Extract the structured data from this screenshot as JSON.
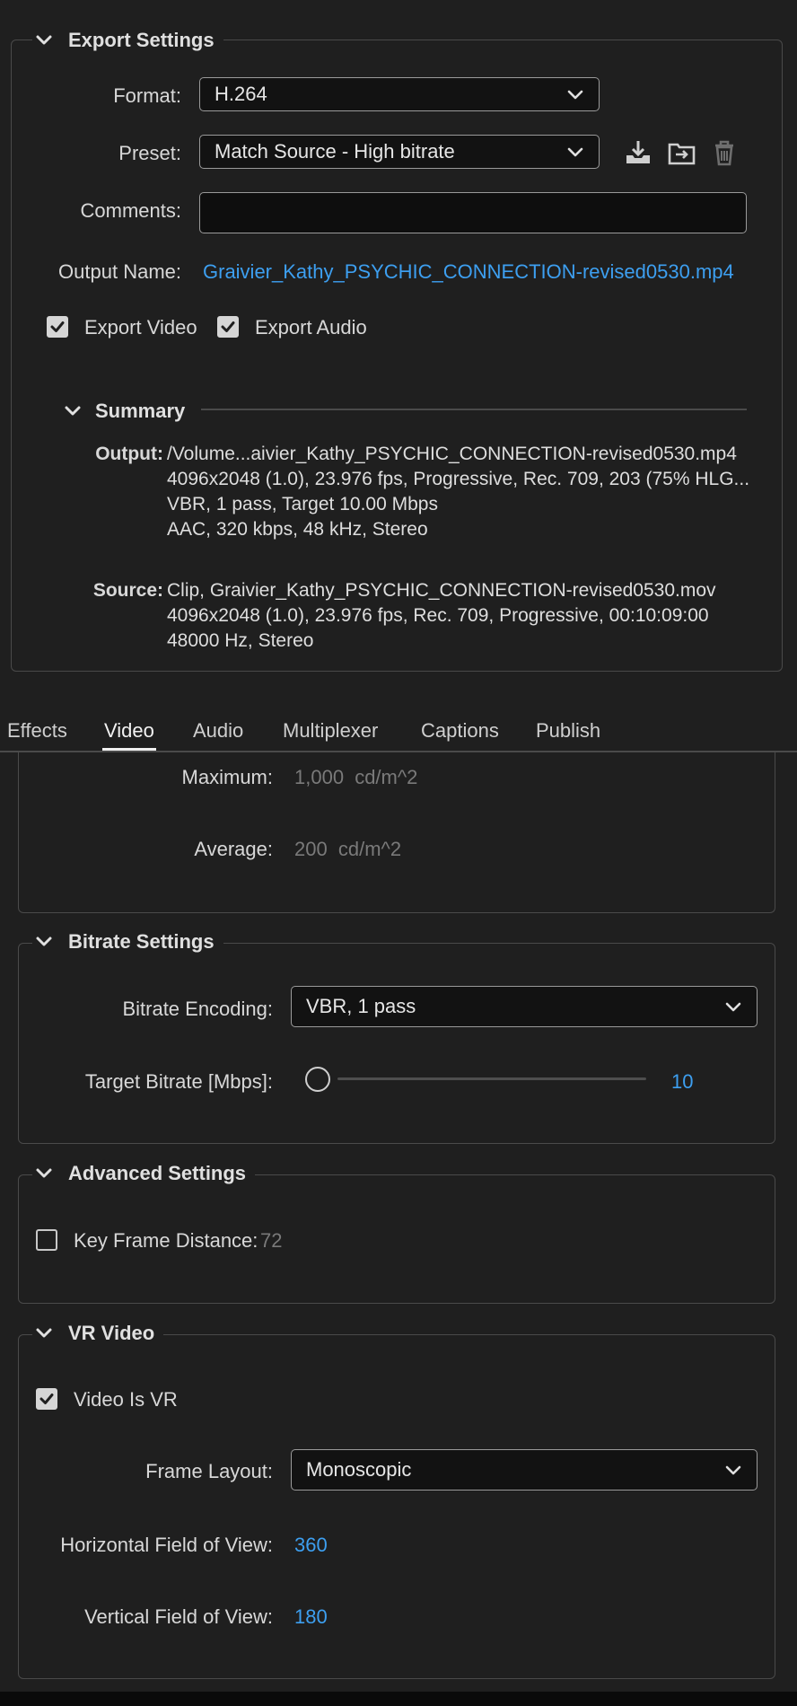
{
  "export_settings": {
    "title": "Export Settings",
    "format": {
      "label": "Format:",
      "value": "H.264"
    },
    "preset": {
      "label": "Preset:",
      "value": "Match Source - High bitrate"
    },
    "preset_icons": [
      "save-preset-icon",
      "import-preset-icon",
      "delete-preset-icon"
    ],
    "comments": {
      "label": "Comments:",
      "value": ""
    },
    "output_name": {
      "label": "Output Name:",
      "value": "Graivier_Kathy_PSYCHIC_CONNECTION-revised0530.mp4"
    },
    "export_video": {
      "label": "Export Video",
      "checked": true
    },
    "export_audio": {
      "label": "Export Audio",
      "checked": true
    }
  },
  "summary": {
    "title": "Summary",
    "output_label": "Output:",
    "output_lines": [
      "/Volume...aivier_Kathy_PSYCHIC_CONNECTION-revised0530.mp4",
      "4096x2048 (1.0), 23.976 fps, Progressive, Rec. 709, 203 (75% HLG...",
      "VBR, 1 pass, Target 10.00 Mbps",
      "AAC, 320 kbps, 48 kHz, Stereo"
    ],
    "source_label": "Source:",
    "source_lines": [
      "Clip, Graivier_Kathy_PSYCHIC_CONNECTION-revised0530.mov",
      "4096x2048 (1.0), 23.976 fps, Rec. 709, Progressive, 00:10:09:00",
      "48000 Hz, Stereo"
    ]
  },
  "tabs": {
    "items": [
      "Effects",
      "Video",
      "Audio",
      "Multiplexer",
      "Captions",
      "Publish"
    ],
    "active": "Video"
  },
  "hdr": {
    "maximum_label": "Maximum:",
    "maximum_value": "1,000",
    "maximum_unit": "cd/m^2",
    "average_label": "Average:",
    "average_value": "200",
    "average_unit": "cd/m^2"
  },
  "bitrate": {
    "title": "Bitrate Settings",
    "encoding_label": "Bitrate Encoding:",
    "encoding_value": "VBR, 1 pass",
    "target_label": "Target Bitrate [Mbps]:",
    "target_value": "10",
    "slider_fraction": 0.0
  },
  "advanced": {
    "title": "Advanced Settings",
    "keyframe_label": "Key Frame Distance:",
    "keyframe_value": "72",
    "keyframe_checked": false
  },
  "vr": {
    "title": "VR Video",
    "video_is_vr_label": "Video Is VR",
    "video_is_vr_checked": true,
    "frame_layout_label": "Frame Layout:",
    "frame_layout_value": "Monoscopic",
    "hfov_label": "Horizontal Field of View:",
    "hfov_value": "360",
    "vfov_label": "Vertical Field of View:",
    "vfov_value": "180"
  },
  "colors": {
    "background": "#1f1f1f",
    "accent": "#3d9ff0",
    "border": "#4a4a4a"
  }
}
